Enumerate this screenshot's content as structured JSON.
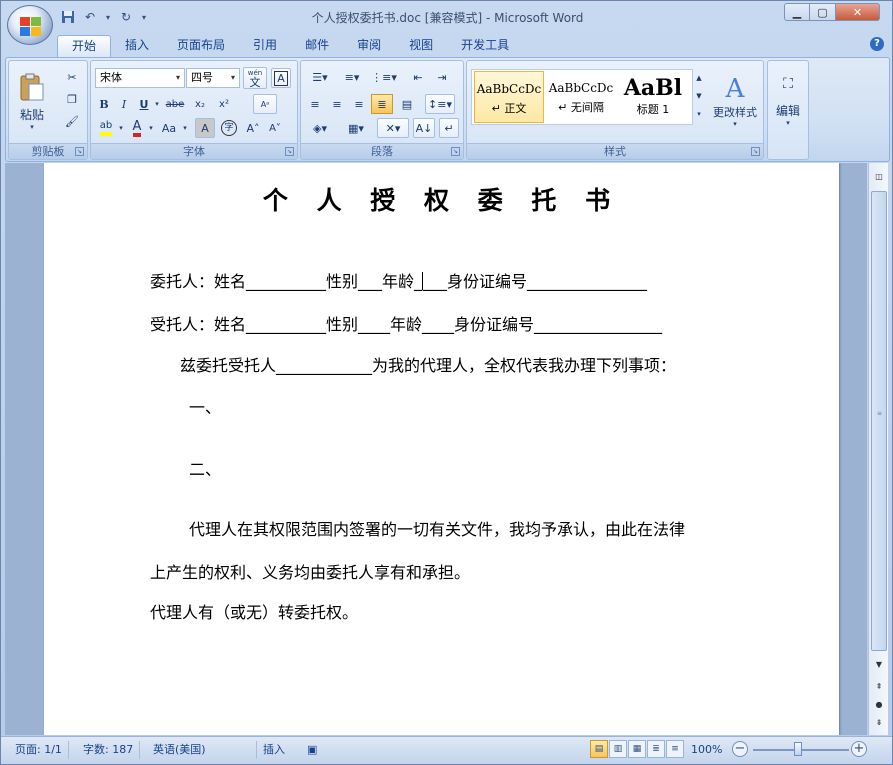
{
  "window": {
    "title": "个人授权委托书.doc [兼容模式] - Microsoft Word"
  },
  "qat": {
    "save_icon": "save-icon",
    "undo_icon": "undo-icon",
    "redo_icon": "redo-icon"
  },
  "tabs": [
    {
      "label": "开始"
    },
    {
      "label": "插入"
    },
    {
      "label": "页面布局"
    },
    {
      "label": "引用"
    },
    {
      "label": "邮件"
    },
    {
      "label": "审阅"
    },
    {
      "label": "视图"
    },
    {
      "label": "开发工具"
    }
  ],
  "ribbon": {
    "clipboard": {
      "paste_label": "粘贴",
      "group_label": "剪贴板"
    },
    "font": {
      "font_name": "宋体",
      "font_size": "四号",
      "group_label": "字体",
      "wen_label": "wén",
      "wen_char": "文",
      "bold": "B",
      "italic": "I",
      "underline": "U",
      "strike": "abe",
      "subscript": "x₂",
      "superscript": "x²",
      "font_color_glyph": "A",
      "case_glyph": "Aa",
      "shading_glyph": "A",
      "enclose_glyph": "字",
      "grow_glyph": "A˄",
      "shrink_glyph": "A˅"
    },
    "paragraph": {
      "group_label": "段落"
    },
    "styles": {
      "group_label": "样式",
      "items": [
        {
          "preview": "AaBbCcDc",
          "name": "↵ 正文"
        },
        {
          "preview": "AaBbCcDc",
          "name": "↵ 无间隔"
        },
        {
          "preview": "AaBl",
          "name": "标题 1"
        }
      ],
      "change_label": "更改样式"
    },
    "editing": {
      "label": "编辑"
    }
  },
  "document": {
    "title": "个 人 授 权 委 托 书",
    "line1a": "委托人：姓名__________性别___年龄_",
    "line1b": "___身份证编号_______________",
    "line2": "受托人：姓名__________性别____年龄____身份证编号________________",
    "line3": "兹委托受托人____________为我的代理人，全权代表我办理下列事项：",
    "item1": "一、",
    "item2": "二、",
    "line4": "代理人在其权限范围内签署的一切有关文件，我均予承认，由此在法律",
    "line5": "上产生的权利、义务均由委托人享有和承担。",
    "line6": "代理人有（或无）转委托权。"
  },
  "status": {
    "page": "页面: 1/1",
    "words": "字数: 187",
    "language": "英语(美国)",
    "mode": "插入",
    "zoom": "100%"
  },
  "colors": {
    "ribbon_text": "#15428b",
    "selected_style": "#f2b53b",
    "doc_background": "#9bb2d3"
  }
}
